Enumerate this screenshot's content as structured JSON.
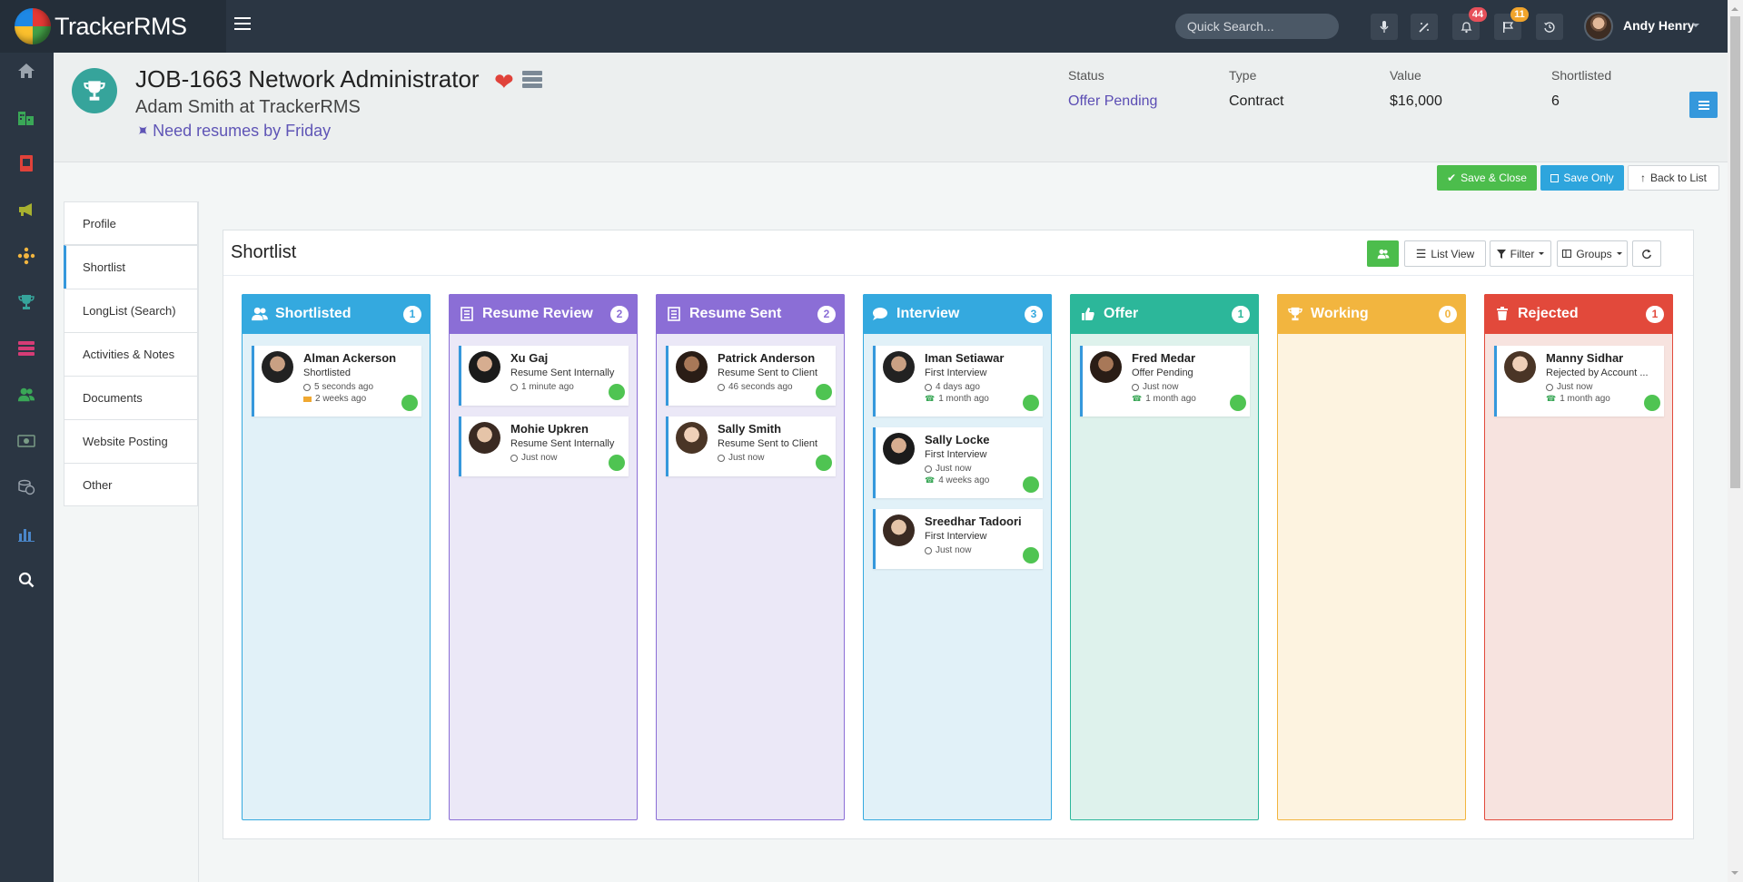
{
  "app": {
    "name": "TrackerRMS"
  },
  "search": {
    "placeholder": "Quick Search..."
  },
  "notifications": {
    "alerts_count": "44",
    "flags_count": "11"
  },
  "user": {
    "name": "Andy Henry"
  },
  "job": {
    "title": "JOB-1663 Network Administrator",
    "client": "Adam Smith at TrackerRMS",
    "note": "Need resumes by Friday"
  },
  "stats": [
    {
      "label": "Status",
      "value": "Offer Pending"
    },
    {
      "label": "Type",
      "value": "Contract"
    },
    {
      "label": "Value",
      "value": "$16,000"
    },
    {
      "label": "Shortlisted",
      "value": "6"
    }
  ],
  "actions": {
    "save_close": "Save & Close",
    "save_only": "Save Only",
    "back": "Back to List"
  },
  "tabs": [
    "Profile",
    "Shortlist",
    "LongList (Search)",
    "Activities & Notes",
    "Documents",
    "Website Posting",
    "Other"
  ],
  "panel": {
    "title": "Shortlist",
    "list_view": "List View",
    "filter": "Filter",
    "groups": "Groups"
  },
  "colors": {
    "topbar": "#2b3643",
    "accent": "#3598dc",
    "green": "#4cbd4c"
  },
  "columns": [
    {
      "name": "Shortlisted",
      "count": "1",
      "icon": "users-icon",
      "color": "#34a9df",
      "bg": "#e1f1f8",
      "cards": [
        {
          "name": "Alman Ackerson",
          "status": "Shortlisted",
          "time1": "5 seconds ago",
          "time2": "2 weeks ago",
          "icon2": "mail"
        }
      ]
    },
    {
      "name": "Resume Review",
      "count": "2",
      "icon": "document-icon",
      "color": "#8b6ed6",
      "bg": "#ebe8f7",
      "cards": [
        {
          "name": "Xu Gaj",
          "status": "Resume Sent Internally",
          "time1": "1 minute ago",
          "time2": ""
        },
        {
          "name": "Mohie Upkren",
          "status": "Resume Sent Internally",
          "time1": "Just now",
          "time2": ""
        }
      ]
    },
    {
      "name": "Resume Sent",
      "count": "2",
      "icon": "document-icon",
      "color": "#8b6ed6",
      "bg": "#ebe8f7",
      "cards": [
        {
          "name": "Patrick Anderson",
          "status": "Resume Sent to Client",
          "time1": "46 seconds ago",
          "time2": ""
        },
        {
          "name": "Sally Smith",
          "status": "Resume Sent to Client",
          "time1": "Just now",
          "time2": ""
        }
      ]
    },
    {
      "name": "Interview",
      "count": "3",
      "icon": "chat-icon",
      "color": "#34a9df",
      "bg": "#e1f1f8",
      "cards": [
        {
          "name": "Iman Setiawar",
          "status": "First Interview",
          "time1": "4 days ago",
          "time2": "1 month ago",
          "icon2": "phone"
        },
        {
          "name": "Sally Locke",
          "status": "First Interview",
          "time1": "Just now",
          "time2": "4 weeks ago",
          "icon2": "phone"
        },
        {
          "name": "Sreedhar Tadoori",
          "status": "First Interview",
          "time1": "Just now",
          "time2": ""
        }
      ]
    },
    {
      "name": "Offer",
      "count": "1",
      "icon": "thumbs-up-icon",
      "color": "#2cb79a",
      "bg": "#def2ec",
      "cards": [
        {
          "name": "Fred Medar",
          "status": "Offer Pending",
          "time1": "Just now",
          "time2": "1 month ago",
          "icon2": "phone"
        }
      ]
    },
    {
      "name": "Working",
      "count": "0",
      "icon": "trophy-icon",
      "color": "#f2b53f",
      "bg": "#fdf3e0",
      "cards": []
    },
    {
      "name": "Rejected",
      "count": "1",
      "icon": "trash-icon",
      "color": "#e2493b",
      "bg": "#f7e3df",
      "cards": [
        {
          "name": "Manny Sidhar",
          "status": "Rejected by Account ...",
          "time1": "Just now",
          "time2": "1 month ago",
          "icon2": "phone"
        }
      ]
    }
  ]
}
